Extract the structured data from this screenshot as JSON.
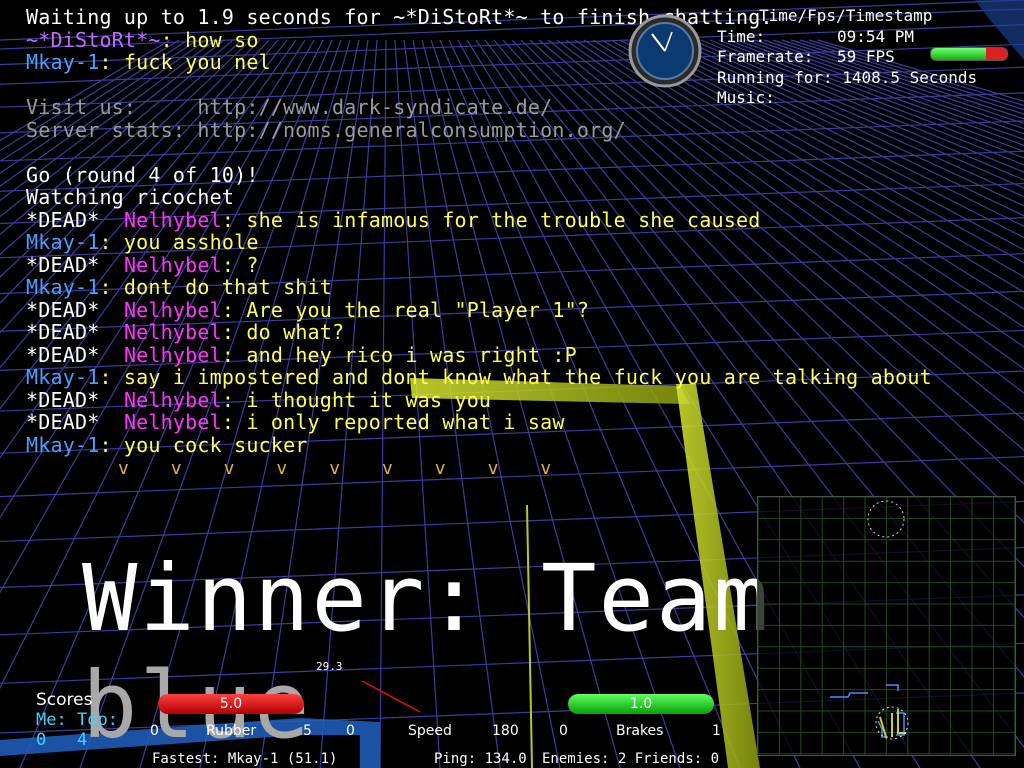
{
  "chat": {
    "lines": [
      {
        "prefix": "",
        "name": "",
        "text": "Waiting up to 1.9 seconds for ~*DiStoRt*~ to finish chatting.",
        "name_color": "white",
        "text_color": "white"
      },
      {
        "prefix": "",
        "name": "~*DiStoRt*~",
        "text": ": how so",
        "name_color": "purple",
        "text_color": "yellow"
      },
      {
        "prefix": "",
        "name": "Mkay-1",
        "text": ": fuck you nel",
        "name_color": "blue",
        "text_color": "yellow"
      },
      {
        "prefix": "",
        "name": "",
        "text": "",
        "name_color": "white",
        "text_color": "white"
      },
      {
        "prefix": "",
        "name": "Visit us:     ",
        "text": "http://www.dark-syndicate.de/",
        "name_color": "grey",
        "text_color": "grey"
      },
      {
        "prefix": "",
        "name": "Server stats: ",
        "text": "http://noms.generalconsumption.org/",
        "name_color": "grey",
        "text_color": "grey"
      },
      {
        "prefix": "",
        "name": "",
        "text": "",
        "name_color": "white",
        "text_color": "white"
      },
      {
        "prefix": "",
        "name": "",
        "text": "Go (round 4 of 10)!",
        "name_color": "white",
        "text_color": "white"
      },
      {
        "prefix": "",
        "name": "",
        "text": "Watching ricochet",
        "name_color": "white",
        "text_color": "white"
      },
      {
        "prefix": "*DEAD*  ",
        "name": "Nelhybel",
        "text": ": she is infamous for the trouble she caused",
        "name_color": "magenta",
        "text_color": "yellow"
      },
      {
        "prefix": "",
        "name": "Mkay-1",
        "text": ": you asshole",
        "name_color": "blue",
        "text_color": "yellow"
      },
      {
        "prefix": "*DEAD*  ",
        "name": "Nelhybel",
        "text": ": ?",
        "name_color": "magenta",
        "text_color": "yellow"
      },
      {
        "prefix": "",
        "name": "Mkay-1",
        "text": ": dont do that shit",
        "name_color": "blue",
        "text_color": "yellow"
      },
      {
        "prefix": "*DEAD*  ",
        "name": "Nelhybel",
        "text": ": Are you the real \"Player 1\"?",
        "name_color": "magenta",
        "text_color": "yellow"
      },
      {
        "prefix": "*DEAD*  ",
        "name": "Nelhybel",
        "text": ": do what?",
        "name_color": "magenta",
        "text_color": "yellow"
      },
      {
        "prefix": "*DEAD*  ",
        "name": "Nelhybel",
        "text": ": and hey rico i was right :P",
        "name_color": "magenta",
        "text_color": "yellow"
      },
      {
        "prefix": "",
        "name": "Mkay-1",
        "text": ": say i impostered and dont know what the fuck you are talking about",
        "name_color": "blue",
        "text_color": "yellow"
      },
      {
        "prefix": "*DEAD*  ",
        "name": "Nelhybel",
        "text": ": i thought it was you",
        "name_color": "magenta",
        "text_color": "yellow"
      },
      {
        "prefix": "*DEAD*  ",
        "name": "Nelhybel",
        "text": ": i only reported what i saw",
        "name_color": "magenta",
        "text_color": "yellow"
      },
      {
        "prefix": "",
        "name": "Mkay-1",
        "text": ": you cock sucker",
        "name_color": "blue",
        "text_color": "yellow"
      }
    ],
    "scroll_arrows": [
      "v",
      "v",
      "v",
      "v",
      "v",
      "v",
      "v",
      "v",
      "v"
    ]
  },
  "hud_top_right": {
    "header": "Time/Fps/Timestamp",
    "time_label": "Time:",
    "time_value": "09:54 PM",
    "framerate_label": "Framerate:",
    "framerate_value": "59 FPS",
    "running_label": "Running for:",
    "running_value": "1408.5 Seconds",
    "music_label": "Music:",
    "music_value": ""
  },
  "health_fraction": 0.72,
  "winner": {
    "prefix": "Winner: Team ",
    "team": "blue"
  },
  "hud_bottom": {
    "scores_label": "Scores",
    "me_label": "Me:",
    "top_label": "Top:",
    "me_value": "0",
    "top_value": "4",
    "rubber_bar_value": "5.0",
    "rubber_min": "0",
    "rubber_label": "Rubber",
    "rubber_max": "5",
    "rubber_fraction": 1.0,
    "speed_top_value": "29.3",
    "speed_min": "0",
    "speed_label": "Speed",
    "speed_max": "180",
    "brakes_bar_value": "1.0",
    "brakes_min": "0",
    "brakes_label": "Brakes",
    "brakes_max": "1",
    "brakes_fraction": 1.0,
    "fastest": "Fastest: Mkay-1 (51.1)",
    "ping": "Ping: 134.0",
    "enemies_friends": "Enemies: 2 Friends: 0"
  },
  "colors": {
    "grid": "#3c3c9e",
    "wall_yellow": "#b8c820",
    "wall_blue": "#2060c0",
    "name_blue": "#4aa0ff",
    "name_magenta": "#ff33ff",
    "text_yellow": "#ffff55"
  }
}
